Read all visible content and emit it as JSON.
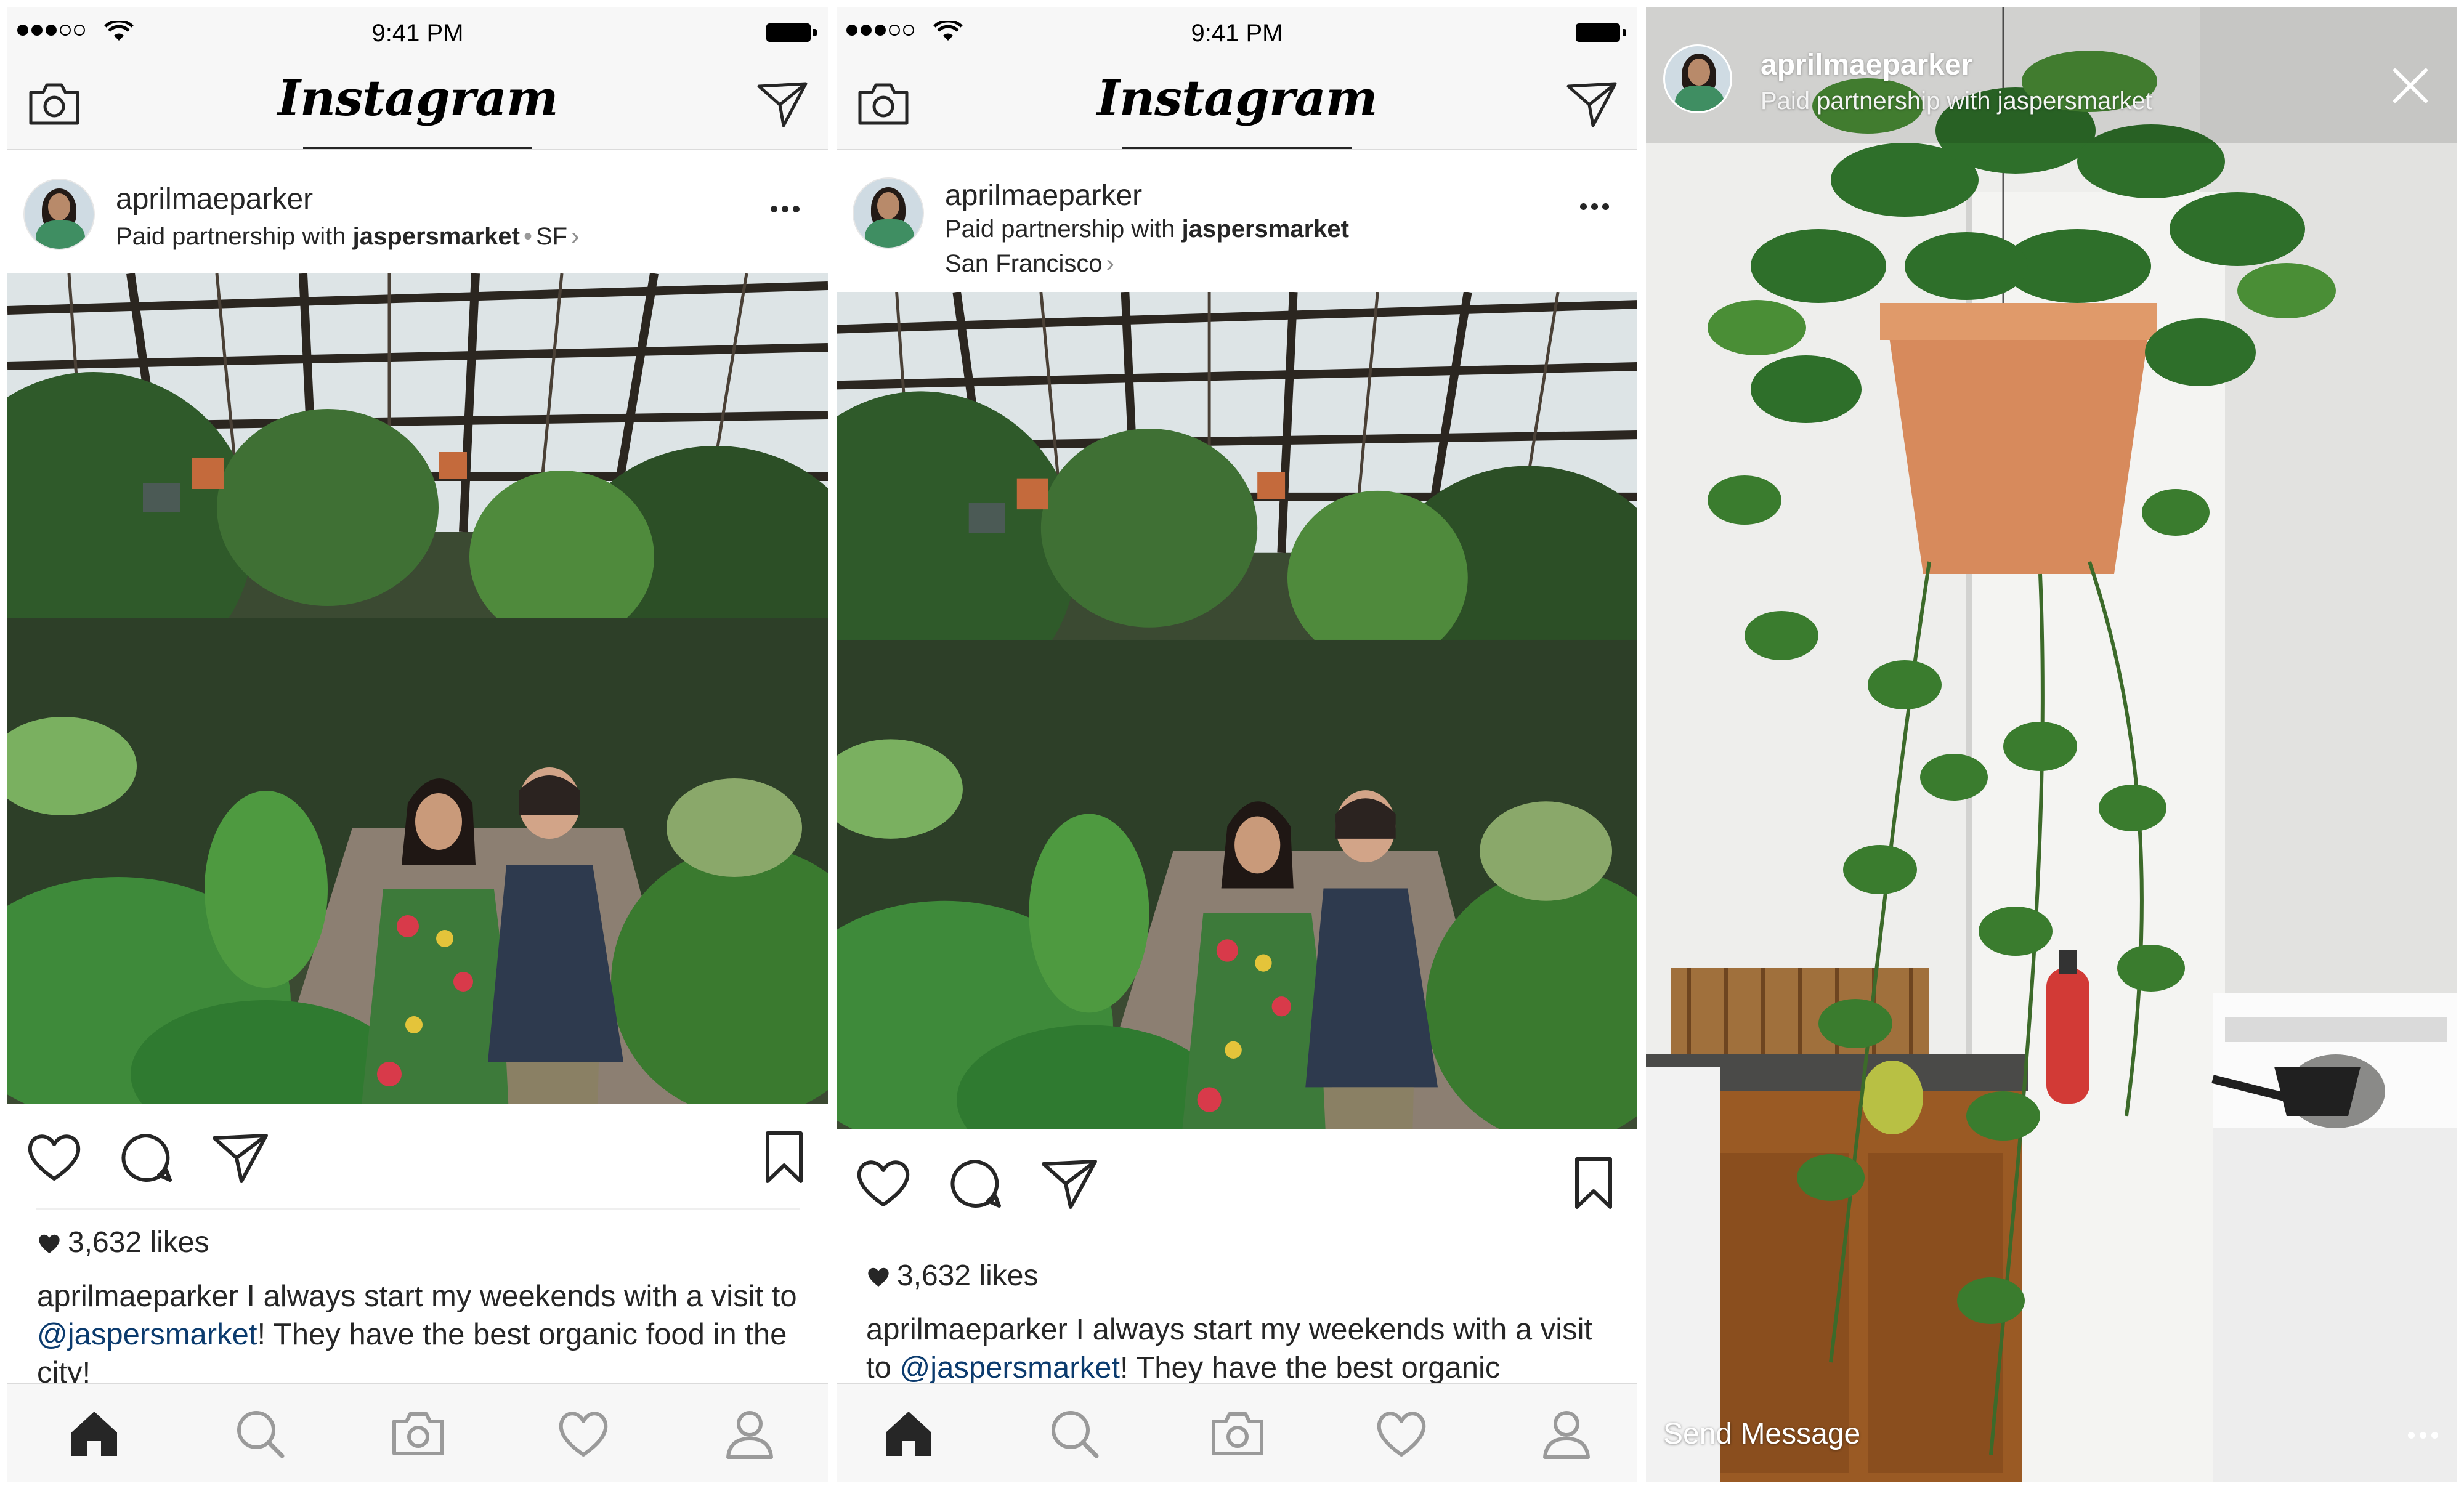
{
  "status_bar": {
    "time": "9:41 PM"
  },
  "app": {
    "logo": "Instagram"
  },
  "post": {
    "username": "aprilmaeparker",
    "partner_prefix": "Paid partnership with",
    "partner": "jaspersmarket",
    "location_short": "SF",
    "location_full": "San Francisco",
    "likes": "3,632 likes",
    "caption_user": "aprilmaeparker",
    "caption_text_1": " I always start my weekends with a visit to ",
    "caption_mention": "@jaspersmarket",
    "caption_text_2": "! They have the best organic food in the city!",
    "caption_text_2_truncated": "! They have the best organic"
  },
  "story": {
    "username": "aprilmaeparker",
    "partner_prefix": "Paid partnership with",
    "partner": "jaspersmarket",
    "send_message": "Send Message"
  },
  "icons": {
    "camera": "camera-icon",
    "direct": "paper-plane-icon",
    "more": "ellipsis-icon",
    "like": "heart-outline-icon",
    "comment": "comment-bubble-icon",
    "share": "paper-plane-icon",
    "save": "bookmark-icon",
    "home": "home-icon",
    "search": "search-icon",
    "activity": "heart-icon",
    "profile": "profile-icon",
    "close": "close-icon"
  },
  "colors": {
    "mention": "#0b3b6e",
    "bars": "#f7f7f7",
    "text": "#262626"
  }
}
